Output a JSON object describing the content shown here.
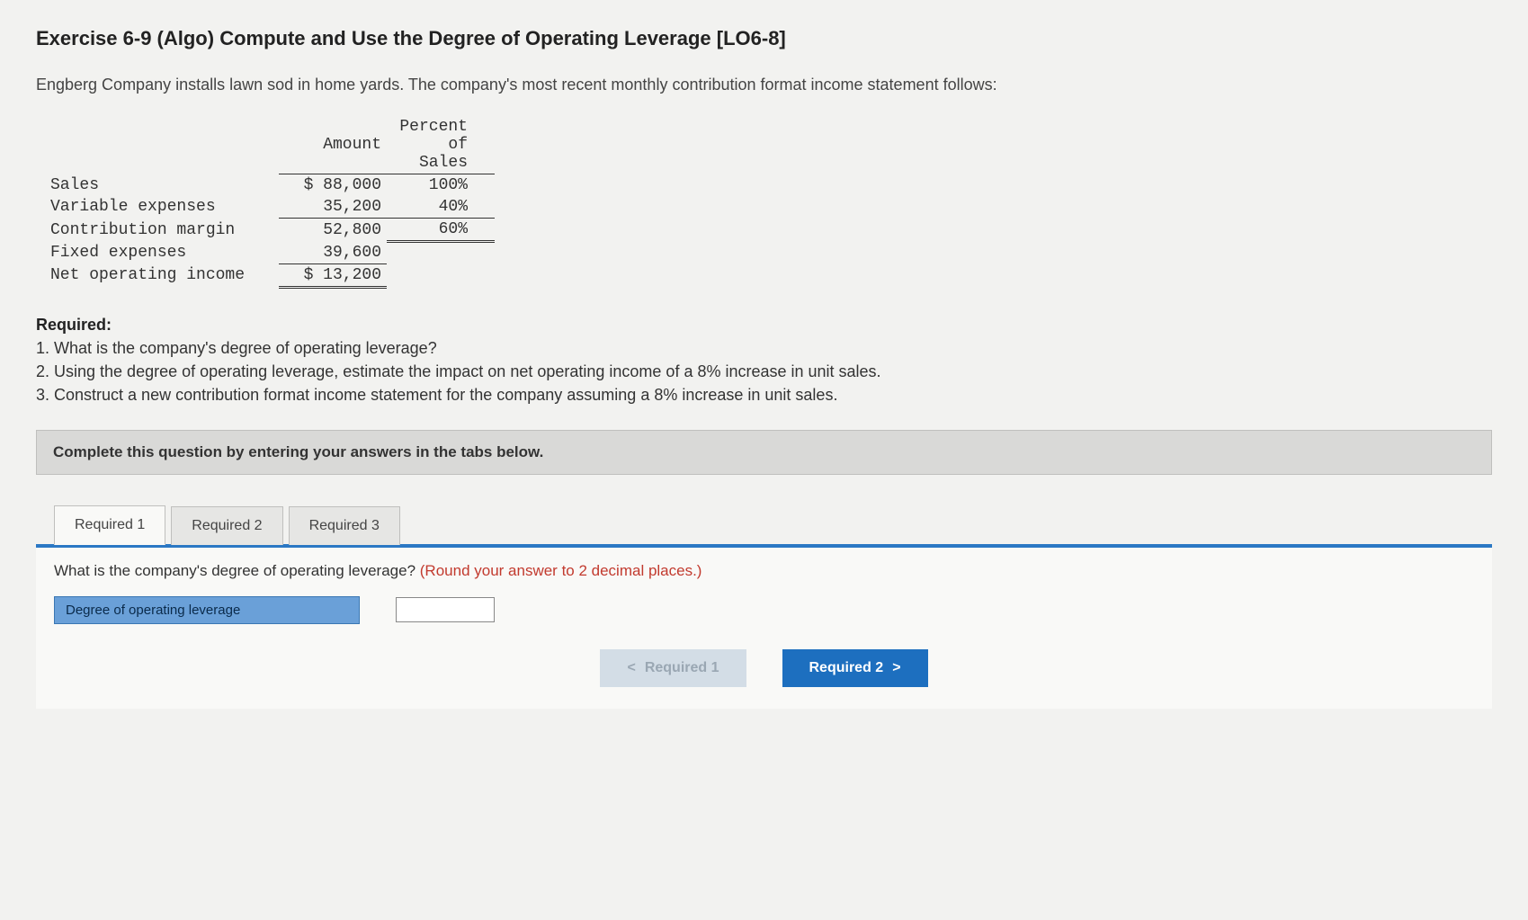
{
  "title": "Exercise 6-9 (Algo) Compute and Use the Degree of Operating Leverage [LO6-8]",
  "intro": "Engberg Company installs lawn sod in home yards. The company's most recent monthly contribution format income statement follows:",
  "table": {
    "headers": {
      "amount": "Amount",
      "percent": "Percent of Sales"
    },
    "rows": {
      "sales": {
        "label": "Sales",
        "amount": "$ 88,000",
        "percent": "100%"
      },
      "var_exp": {
        "label": "Variable expenses",
        "amount": "35,200",
        "percent": "40%"
      },
      "contrib": {
        "label": "Contribution margin",
        "amount": "52,800",
        "percent": "60%"
      },
      "fixed_exp": {
        "label": "Fixed expenses",
        "amount": "39,600",
        "percent": ""
      },
      "noi": {
        "label": "Net operating income",
        "amount": "$ 13,200",
        "percent": ""
      }
    }
  },
  "required": {
    "title": "Required:",
    "l1": "1. What is the company's degree of operating leverage?",
    "l2": "2. Using the degree of operating leverage, estimate the impact on net operating income of a 8% increase in unit sales.",
    "l3": "3. Construct a new contribution format income statement for the company assuming a 8% increase in unit sales."
  },
  "instruction": "Complete this question by entering your answers in the tabs below.",
  "tabs": {
    "t1": "Required 1",
    "t2": "Required 2",
    "t3": "Required 3"
  },
  "panel": {
    "question": "What is the company's degree of operating leverage? ",
    "hint": "(Round your answer to 2 decimal places.)",
    "answer_label": "Degree of operating leverage",
    "answer_value": ""
  },
  "nav": {
    "prev_chev": "<",
    "prev": "Required 1",
    "next": "Required 2",
    "next_chev": ">"
  }
}
